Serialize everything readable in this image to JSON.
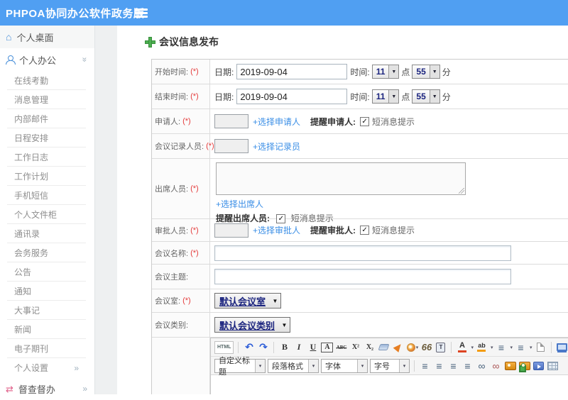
{
  "colors": {
    "header_bg": "#509ff2",
    "link_blue": "#3a8ee6",
    "required_red": "#e43b3b",
    "select_navy": "#1a237e",
    "plus_green": "#4CAF50",
    "sidebar_icon_blue": "#4a90d9",
    "supervise_pink": "#e0608a"
  },
  "icons": {
    "chevron_double": "»",
    "caret_down_small": "▼",
    "caret_tiny": "▾",
    "check": "✓",
    "home": "⌂",
    "shuffle": "⇄"
  },
  "header": {
    "title": "PHPOA协同办公软件政务版"
  },
  "sidebar": {
    "items": [
      {
        "label": "个人桌面"
      },
      {
        "label": "个人办公"
      },
      {
        "label": "在线考勤"
      },
      {
        "label": "消息管理"
      },
      {
        "label": "内部邮件"
      },
      {
        "label": "日程安排"
      },
      {
        "label": "工作日志"
      },
      {
        "label": "工作计划"
      },
      {
        "label": "手机短信"
      },
      {
        "label": "个人文件柜"
      },
      {
        "label": "通讯录"
      },
      {
        "label": "会务服务"
      },
      {
        "label": "公告"
      },
      {
        "label": "通知"
      },
      {
        "label": "大事记"
      },
      {
        "label": "新闻"
      },
      {
        "label": "电子期刊"
      },
      {
        "label": "个人设置"
      },
      {
        "label": "督查督办"
      }
    ]
  },
  "page": {
    "title": "会议信息发布"
  },
  "form": {
    "start_time": {
      "label": "开始时间:",
      "req": "(*)",
      "date_label": "日期:",
      "date_value": "2019-09-04",
      "time_label": "时间:",
      "hour": "11",
      "hour_unit": "点",
      "minute": "55",
      "minute_unit": "分"
    },
    "end_time": {
      "label": "结束时间:",
      "req": "(*)",
      "date_label": "日期:",
      "date_value": "2019-09-04",
      "time_label": "时间:",
      "hour": "11",
      "hour_unit": "点",
      "minute": "55",
      "minute_unit": "分"
    },
    "applicant": {
      "label": "申请人:",
      "req": "(*)",
      "link": "+选择申请人",
      "remind": "提醒申请人:",
      "sms": "短消息提示"
    },
    "recorder": {
      "label": "会议记录人员:",
      "req": "(*)",
      "link": "+选择记录员"
    },
    "attendees": {
      "label": "出席人员:",
      "req": "(*)",
      "link": "+选择出席人",
      "remind": "提醒出席人员:",
      "sms": "短消息提示"
    },
    "approver": {
      "label": "审批人员:",
      "req": "(*)",
      "link": "+选择审批人",
      "remind": "提醒审批人:",
      "sms": "短消息提示"
    },
    "meeting_name": {
      "label": "会议名称:",
      "req": "(*)"
    },
    "meeting_subject": {
      "label": "会议主题:"
    },
    "meeting_room": {
      "label": "会议室:",
      "req": "(*)",
      "value": "默认会议室"
    },
    "meeting_type": {
      "label": "会议类别:",
      "value": "默认会议类别"
    }
  },
  "editor": {
    "selects": [
      {
        "label": "自定义标题"
      },
      {
        "label": "段落格式"
      },
      {
        "label": "字体"
      },
      {
        "label": "字号"
      }
    ],
    "glyphs": {
      "html": "HTML",
      "undo": "↶",
      "redo": "↷",
      "bold": "B",
      "italic": "I",
      "underline": "U",
      "fontbox": "A",
      "strike": "ABC",
      "sup": "X²",
      "sub": "X₂",
      "quote": "66",
      "paste_t": "T",
      "fontcolor": "A",
      "highlight": "ab",
      "list": "≡",
      "align": "≡",
      "link": "∞",
      "unlink": "∞"
    }
  }
}
